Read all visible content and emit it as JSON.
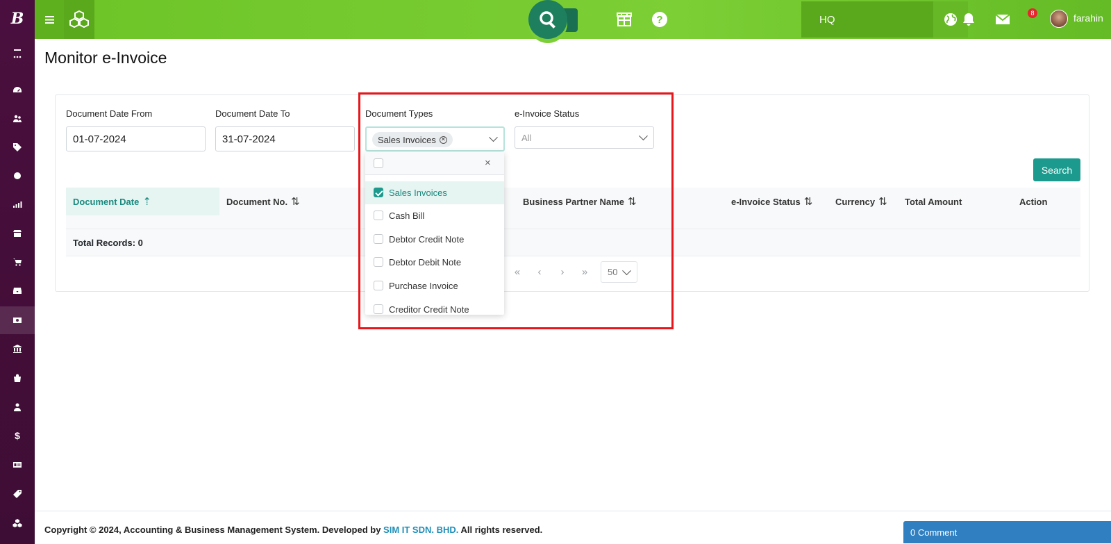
{
  "app": {
    "logo": "B",
    "location": "HQ",
    "username": "farahin",
    "mail_badge": "8"
  },
  "colors": {
    "topbar": "#7ccf35",
    "sidebar": "#4a0f3e",
    "accent": "#1b9a8d",
    "highlight": "#e8161b",
    "link": "#1f8fb8",
    "comment": "#2f7fc1"
  },
  "sidebar": {
    "icons": [
      "menu-collapse-icon",
      "more-icon",
      "dashboard-icon",
      "users-icon",
      "tag-icon",
      "circle-icon",
      "chart-icon",
      "store-icon",
      "cart-icon",
      "inbox-icon",
      "money-icon",
      "bank-icon",
      "bag-icon",
      "person-icon",
      "dollar-icon",
      "id-card-icon",
      "label-icon",
      "cubes-icon"
    ],
    "dollar_glyph": "$"
  },
  "page": {
    "title": "Monitor e-Invoice"
  },
  "filters": {
    "date_from_label": "Document Date From",
    "date_from_value": "01-07-2024",
    "date_to_label": "Document Date To",
    "date_to_value": "31-07-2024",
    "doc_types_label": "Document Types",
    "doc_types_selected": "Sales Invoices",
    "status_label": "e-Invoice Status",
    "status_placeholder": "All",
    "search_button": "Search"
  },
  "dropdown": {
    "close": "×",
    "options": [
      {
        "label": "Sales Invoices",
        "checked": true
      },
      {
        "label": "Cash Bill",
        "checked": false
      },
      {
        "label": "Debtor Credit Note",
        "checked": false
      },
      {
        "label": "Debtor Debit Note",
        "checked": false
      },
      {
        "label": "Purchase Invoice",
        "checked": false
      },
      {
        "label": "Creditor Credit Note",
        "checked": false
      }
    ]
  },
  "table": {
    "columns": [
      "Document Date",
      "Document No.",
      "Business Partner Name",
      "e-Invoice Status",
      "Currency",
      "Total Amount",
      "Action"
    ],
    "total_records": "Total Records: 0"
  },
  "pagination": {
    "first": "«",
    "prev": "‹",
    "next": "›",
    "last": "»",
    "page_size": "50"
  },
  "footer": {
    "text_before": "Copyright © 2024, Accounting & Business Management System. Developed by ",
    "company": "SIM IT SDN. BHD.",
    "text_after": " All rights reserved.",
    "comment_button": "0 Comment"
  }
}
